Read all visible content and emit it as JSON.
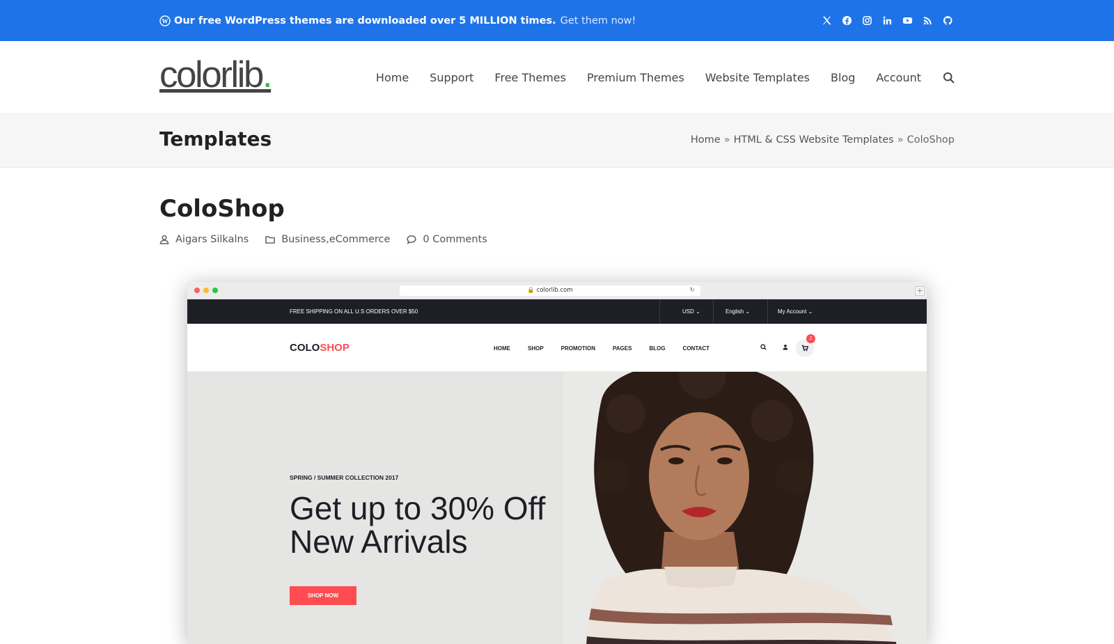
{
  "topbar": {
    "strong": "Our free WordPress themes are downloaded over 5 MILLION times.",
    "link": "Get them now!",
    "social_icons": [
      "x-icon",
      "facebook-icon",
      "instagram-icon",
      "linkedin-icon",
      "youtube-icon",
      "rss-icon",
      "github-icon"
    ],
    "color": "#1e73e8"
  },
  "header": {
    "logo_text": "colorlib",
    "logo_dot": ".",
    "logo_dot_color": "#4caf50",
    "nav": [
      "Home",
      "Support",
      "Free Themes",
      "Premium Themes",
      "Website Templates",
      "Blog",
      "Account"
    ]
  },
  "titleband": {
    "title": "Templates",
    "breadcrumb": [
      "Home",
      "HTML & CSS Website Templates",
      "ColoShop"
    ],
    "separator": "»"
  },
  "post": {
    "title": "ColoShop",
    "author": "Aigars Silkalns",
    "categories": [
      "Business",
      "eCommerce"
    ],
    "category_separator": ", ",
    "comments": "0 Comments"
  },
  "screenshot": {
    "url": "colorlib.com",
    "shipping": "FREE SHIPPING ON ALL U.S ORDERS OVER $50",
    "currency": "USD",
    "language": "English",
    "account": "My Account",
    "logo_a": "COLO",
    "logo_b": "SHOP",
    "nav": [
      "HOME",
      "SHOP",
      "PROMOTION",
      "PAGES",
      "BLOG",
      "CONTACT"
    ],
    "cart_count": "2",
    "eyebrow": "SPRING / SUMMER COLLECTION 2017",
    "headline_1": "Get up to 30% Off",
    "headline_2": "New Arrivals",
    "cta": "SHOP NOW",
    "accent": "#fe4c50"
  }
}
